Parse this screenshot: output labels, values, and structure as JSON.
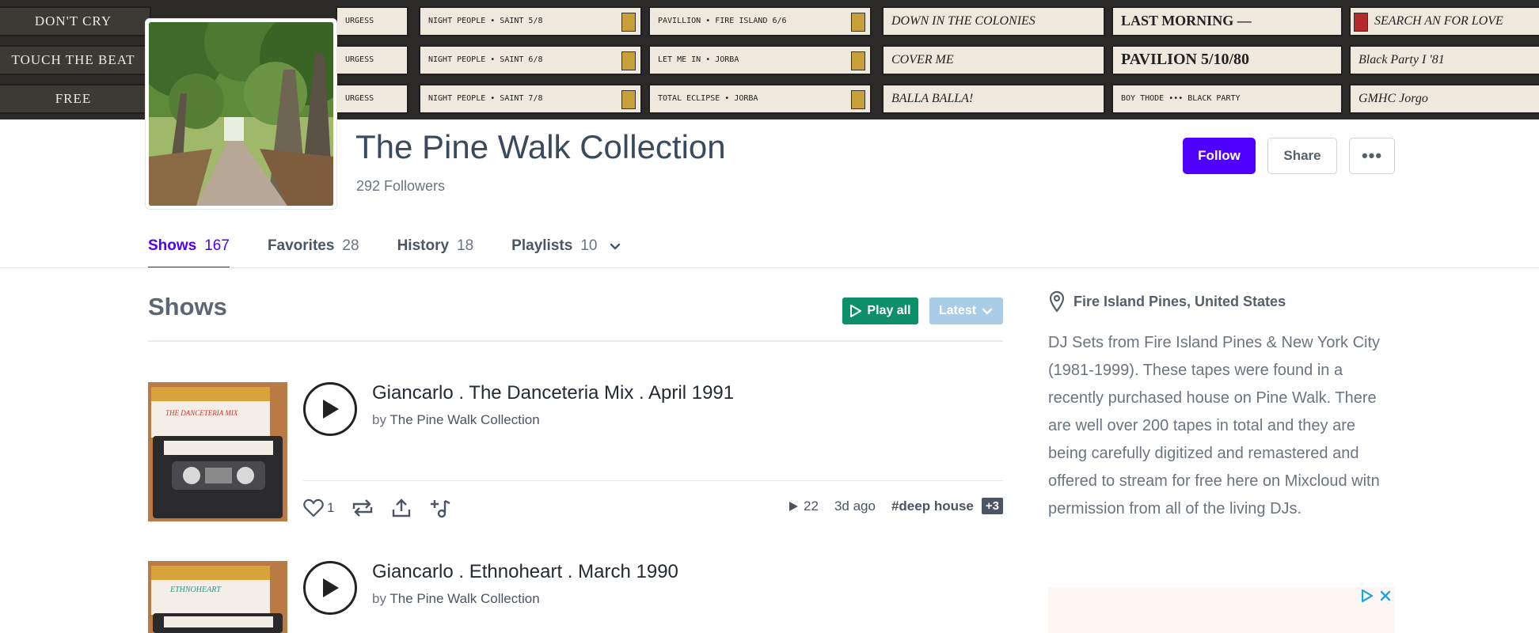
{
  "banner": {
    "tapes": [
      [
        "DON'T CRY",
        "TOUCH THE BEAT",
        "FREE"
      ],
      [
        "URGESS",
        "URGESS",
        "URGESS"
      ],
      [
        "NIGHT PEOPLE • SAINT 5/8",
        "NIGHT PEOPLE • SAINT 6/8",
        "NIGHT PEOPLE • SAINT 7/8"
      ],
      [
        "PAVILLION • FIRE ISLAND 6/6",
        "LET ME IN • JORBA",
        "TOTAL ECLIPSE • JORBA"
      ],
      [
        "DOWN IN THE COLONIES",
        "COVER ME",
        "BALLA BALLA!"
      ],
      [
        "LAST MORNING —",
        "PAVILION 5/10/80",
        "BOY THODE ••• BLACK PARTY"
      ],
      [
        "SEARCH AN FOR LOVE",
        "Black Party I '81",
        "GMHC Jorgo"
      ]
    ]
  },
  "profile": {
    "name": "The Pine Walk Collection",
    "followers": "292 Followers"
  },
  "actions": {
    "follow": "Follow",
    "share": "Share",
    "more": "•••"
  },
  "tabs": [
    {
      "label": "Shows",
      "count": "167"
    },
    {
      "label": "Favorites",
      "count": "28"
    },
    {
      "label": "History",
      "count": "18"
    },
    {
      "label": "Playlists",
      "count": "10"
    }
  ],
  "shows_section": {
    "title": "Shows",
    "play_all": "Play all",
    "sort": "Latest"
  },
  "shows": [
    {
      "title": "Giancarlo . The Danceteria Mix . April 1991",
      "by": "by",
      "owner": "The Pine Walk Collection",
      "likes": "1",
      "plays": "22",
      "age": "3d ago",
      "tag": "#deep house",
      "more_tags": "+3",
      "tape_label": "THE DANCETERIA MIX"
    },
    {
      "title": "Giancarlo . Ethnoheart . March 1990",
      "by": "by",
      "owner": "The Pine Walk Collection",
      "tape_label": "ETHNOHEART"
    }
  ],
  "sidebar": {
    "location": "Fire Island Pines, United States",
    "bio": "DJ Sets from Fire Island Pines & New York City (1981-1999). These tapes were found in a recently purchased house on Pine Walk. There are well over 200 tapes in total and they are being carefully digitized and remastered and offered to stream for free here on Mixcloud witn permission from all of the living DJs."
  },
  "colors": {
    "accent": "#5000ff",
    "play_all": "#0d8f6a",
    "latest": "#a9cde6",
    "text": "#3a4452"
  },
  "icons": [
    "location-pin-icon",
    "play-icon",
    "heart-icon",
    "repost-icon",
    "share-icon",
    "add-to-playlist-icon",
    "chevron-down-icon",
    "ad-choices-icon",
    "close-icon"
  ]
}
